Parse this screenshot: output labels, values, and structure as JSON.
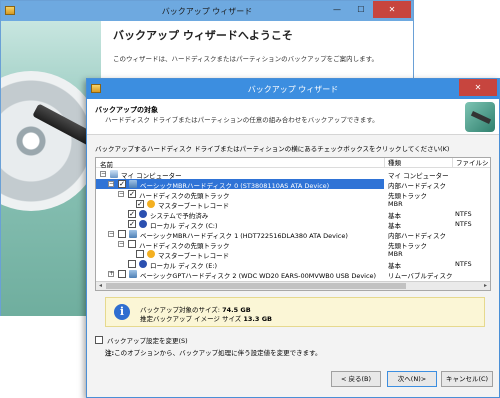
{
  "back_window": {
    "title": "バックアップ ウィザード",
    "heading": "バックアップ ウィザードへようこそ",
    "description": "このウィザードは、ハードディスクまたはパーティションのバックアップをご案内します。"
  },
  "front_window": {
    "title": "バックアップ ウィザード",
    "header_title": "バックアップの対象",
    "header_subtitle": "ハードディスク ドライブまたはパーティションの任意の組み合わせをバックアップできます。",
    "instruction": "バックアップするハードディスク ドライブまたはパーティションの横にあるチェックボックスをクリックしてください(K)",
    "columns": {
      "name": "名前",
      "type": "種類",
      "fs": "ファイルシ"
    },
    "tree_rows": [
      {
        "name": "マイ コンピューター",
        "type": "マイ コンピューター",
        "fs": ""
      },
      {
        "name": "ベーシックMBRハードディスク 0 (ST3808110AS ATA Device)",
        "type": "内部ハードディスク",
        "fs": ""
      },
      {
        "name": "ハードディスクの先頭トラック",
        "type": "先頭トラック",
        "fs": ""
      },
      {
        "name": "マスターブートレコード",
        "type": "MBR",
        "fs": ""
      },
      {
        "name": "システムで予約済み",
        "type": "基本",
        "fs": "NTFS"
      },
      {
        "name": "ローカル ディスク (C:)",
        "type": "基本",
        "fs": "NTFS"
      },
      {
        "name": "ベーシックMBRハードディスク 1 (HDT722516DLA380 ATA Device)",
        "type": "内部ハードディスク",
        "fs": ""
      },
      {
        "name": "ハードディスクの先頭トラック",
        "type": "先頭トラック",
        "fs": ""
      },
      {
        "name": "マスターブートレコード",
        "type": "MBR",
        "fs": ""
      },
      {
        "name": "ローカル ディスク (E:)",
        "type": "基本",
        "fs": "NTFS"
      },
      {
        "name": "ベーシックGPTハードディスク 2 (WDC WD20 EARS-00MVWB0 USB Device)",
        "type": "リムーバブルディスク",
        "fs": ""
      }
    ],
    "info": {
      "label1": "バックアップ対象のサイズ:",
      "value1": "74.5 GB",
      "label2": "推定バックアップ イメージ サイズ",
      "value2": "13.3 GB"
    },
    "option_label": "バックアップ設定を変更(S)",
    "note_prefix": "注:",
    "note_text": "このオプションから、バックアップ処理に伴う設定値を変更できます。",
    "buttons": {
      "back": "< 戻る(B)",
      "next": "次へ(N)>",
      "cancel": "キャンセル(C)"
    }
  },
  "window_controls": {
    "minimize": "—",
    "maximize": "☐",
    "close": "✕"
  }
}
